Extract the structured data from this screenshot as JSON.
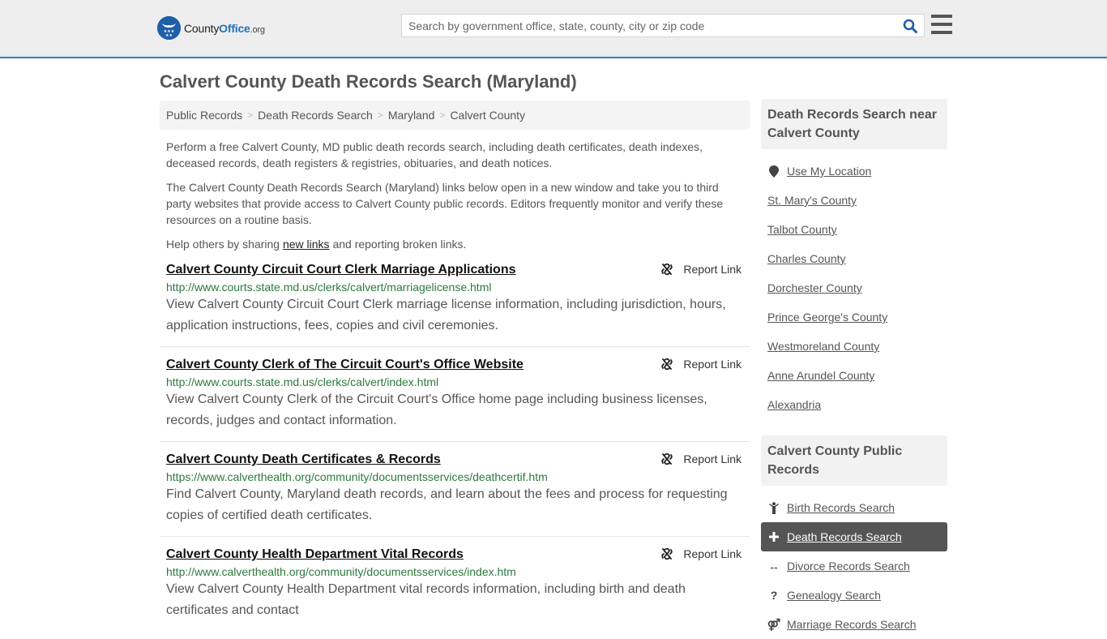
{
  "header": {
    "logo": {
      "brand_prefix": "County",
      "brand_accent": "Office",
      "brand_tld": ".org",
      "icon": "eagle-stars-badge-icon"
    },
    "search": {
      "placeholder": "Search by government office, state, county, city or zip code",
      "value": "",
      "icon": "search-icon"
    },
    "menu_icon": "hamburger-menu-icon"
  },
  "page": {
    "title": "Calvert County Death Records Search (Maryland)"
  },
  "breadcrumb": [
    {
      "label": "Public Records"
    },
    {
      "label": "Death Records Search"
    },
    {
      "label": "Maryland"
    },
    {
      "label": "Calvert County"
    }
  ],
  "breadcrumb_separator": ">",
  "intro": {
    "p1": "Perform a free Calvert County, MD public death records search, including death certificates, death indexes, deceased records, death registers & registries, obituaries, and death notices.",
    "p2": "The Calvert County Death Records Search (Maryland) links below open in a new window and take you to third party websites that provide access to Calvert County public records. Editors frequently monitor and verify these resources on a routine basis.",
    "p3_before": "Help others by sharing ",
    "p3_link": "new links",
    "p3_after": " and reporting broken links."
  },
  "records": [
    {
      "title": "Calvert County Circuit Court Clerk Marriage Applications",
      "url": "http://www.courts.state.md.us/clerks/calvert/marriagelicense.html",
      "description": "View Calvert County Circuit Court Clerk marriage license information, including jurisdiction, hours, application instructions, fees, copies and civil ceremonies.",
      "report_label": "Report Link"
    },
    {
      "title": "Calvert County Clerk of The Circuit Court's Office Website",
      "url": "http://www.courts.state.md.us/clerks/calvert/index.html",
      "description": "View Calvert County Clerk of the Circuit Court's Office home page including business licenses, records, judges and contact information.",
      "report_label": "Report Link"
    },
    {
      "title": "Calvert County Death Certificates & Records",
      "url": "https://www.calverthealth.org/community/documentsservices/deathcertif.htm",
      "description": "Find Calvert County, Maryland death records, and learn about the fees and process for requesting copies of certified death certificates.",
      "report_label": "Report Link"
    },
    {
      "title": "Calvert County Health Department Vital Records",
      "url": "http://www.calverthealth.org/community/documentsservices/index.htm",
      "description": "View Calvert County Health Department vital records information, including birth and death certificates and contact",
      "report_label": "Report Link"
    }
  ],
  "sidebar": {
    "nearby": {
      "heading": "Death Records Search near Calvert County",
      "use_location": {
        "label": "Use My Location",
        "icon": "map-pin-icon"
      },
      "items": [
        {
          "label": "St. Mary's County"
        },
        {
          "label": "Talbot County"
        },
        {
          "label": "Charles County"
        },
        {
          "label": "Dorchester County"
        },
        {
          "label": "Prince George's County"
        },
        {
          "label": "Westmoreland County"
        },
        {
          "label": "Anne Arundel County"
        },
        {
          "label": "Alexandria"
        }
      ]
    },
    "public_records": {
      "heading": "Calvert County Public Records",
      "items": [
        {
          "label": "Birth Records Search",
          "icon": "child-icon",
          "glyph": "Ὣ8",
          "active": false
        },
        {
          "label": "Death Records Search",
          "icon": "plus-cross-icon",
          "glyph": "+",
          "active": true
        },
        {
          "label": "Divorce Records Search",
          "icon": "arrows-left-right-icon",
          "glyph": "↔",
          "active": false
        },
        {
          "label": "Genealogy Search",
          "icon": "question-icon",
          "glyph": "?",
          "active": false
        },
        {
          "label": "Marriage Records Search",
          "icon": "marriage-symbol-icon",
          "glyph": "⚤",
          "active": false
        }
      ]
    }
  },
  "colors": {
    "header_bg": "#eeeeee",
    "header_border": "#3a7fb0",
    "brand_blue": "#1f5fa8",
    "url_green": "#2c7a3b",
    "active_item_bg": "#555555",
    "text": "#555555"
  }
}
